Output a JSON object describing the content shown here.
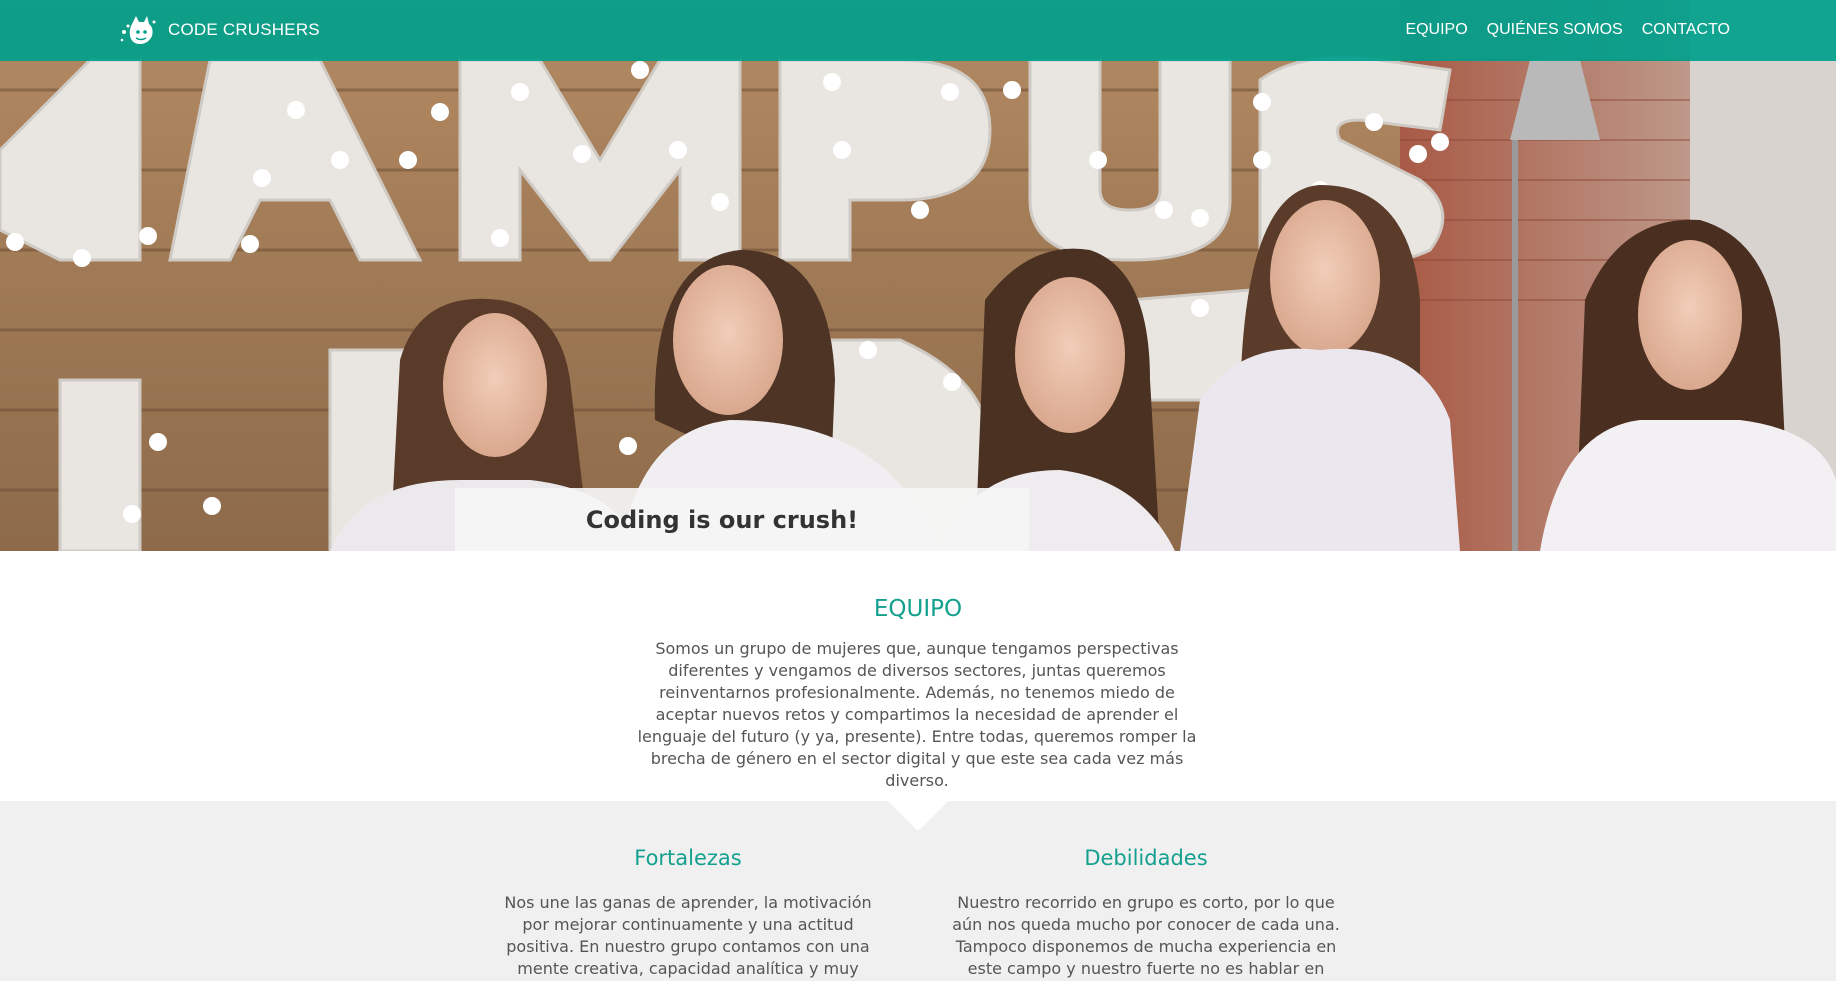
{
  "navbar": {
    "brand_name": "CODE CRUSHERS",
    "brand_logo_icon": "cat-paw-logo-icon",
    "links": [
      "EQUIPO",
      "QUIÉNES SOMOS",
      "CONTACTO"
    ],
    "background_color": "#00a08c"
  },
  "hero": {
    "image_icon": "team-photo",
    "tagline": "Coding is our crush!"
  },
  "team": {
    "title": "EQUIPO",
    "text": "Somos un grupo de mujeres que, aunque tengamos perspectivas diferentes y vengamos de diversos sectores, juntas queremos reinventarnos profesionalmente. Además, no tenemos miedo de aceptar nuevos retos y compartimos la necesidad de aprender el lenguaje del futuro (y ya, presente). Entre todas, queremos romper la brecha de género en el sector digital y que este sea cada vez más diverso."
  },
  "strengths": {
    "title": "Fortalezas",
    "text": "Nos une las ganas de aprender, la motivación por mejorar continuamente y una actitud positiva. En nuestro grupo contamos con una mente creativa, capacidad analítica y muy buenas habilidades"
  },
  "weaknesses": {
    "title": "Debilidades",
    "text": "Nuestro recorrido en grupo es corto, por lo que aún nos queda mucho por conocer de cada una. Tampoco disponemos de mucha experiencia en este campo y nuestro fuerte no es hablar en público (todavía)."
  },
  "colors": {
    "accent": "#13a08e",
    "section_bg": "#f0f0f0",
    "body_text": "#555555"
  }
}
